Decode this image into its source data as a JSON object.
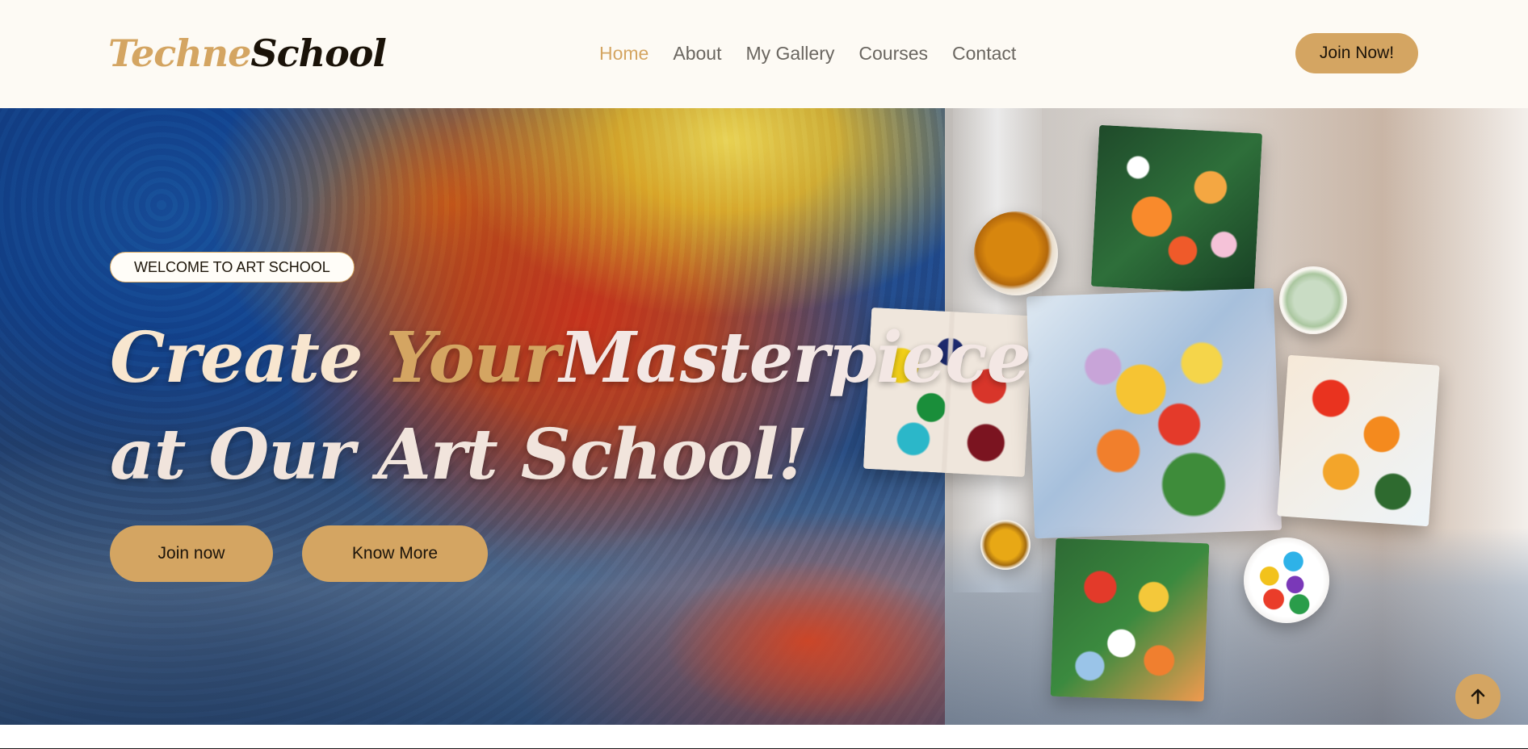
{
  "brand": {
    "part1": "Techne",
    "part2": "School"
  },
  "nav": {
    "items": [
      {
        "label": "Home",
        "active": true
      },
      {
        "label": "About",
        "active": false
      },
      {
        "label": "My Gallery",
        "active": false
      },
      {
        "label": "Courses",
        "active": false
      },
      {
        "label": "Contact",
        "active": false
      }
    ],
    "cta_label": "Join Now!"
  },
  "hero": {
    "badge": "WELCOME TO ART SCHOOL",
    "headline": {
      "line1": {
        "w1": "Create",
        "w2": "Your",
        "w3": "Masterpiece"
      },
      "line2": "at Our Art School!"
    },
    "buttons": {
      "primary": "Join now",
      "secondary": "Know More"
    }
  },
  "icons": {
    "back_to_top": "arrow-up-icon"
  },
  "colors": {
    "accent": "#d4a562",
    "header_bg": "#fdfaf4",
    "nav_text": "#6a6660",
    "dark_text": "#1c140a"
  }
}
